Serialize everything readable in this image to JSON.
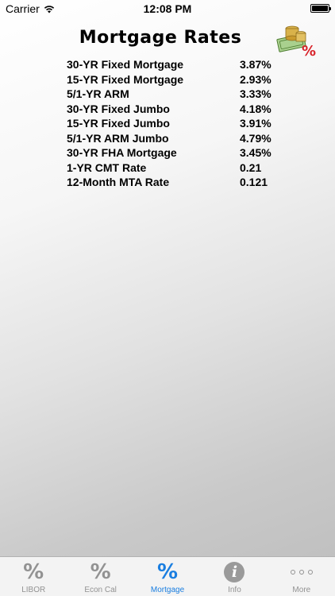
{
  "status_bar": {
    "carrier": "Carrier",
    "time": "12:08 PM"
  },
  "header": {
    "title": "Mortgage Rates",
    "icon": "money-percent-icon"
  },
  "rates": [
    {
      "label": "30-YR Fixed Mortgage",
      "value": "3.87%"
    },
    {
      "label": "15-YR Fixed Mortgage",
      "value": "2.93%"
    },
    {
      "label": "5/1-YR ARM",
      "value": "3.33%"
    },
    {
      "label": "30-YR Fixed Jumbo",
      "value": "4.18%"
    },
    {
      "label": "15-YR Fixed Jumbo",
      "value": "3.91%"
    },
    {
      "label": "5/1-YR ARM Jumbo",
      "value": "4.79%"
    },
    {
      "label": "30-YR FHA Mortgage",
      "value": "3.45%"
    },
    {
      "label": "1-YR CMT Rate",
      "value": "0.21"
    },
    {
      "label": "12-Month MTA Rate",
      "value": "0.121"
    }
  ],
  "tab_bar": {
    "active": "Mortgage",
    "accent_color": "#1a7ee0",
    "inactive_color": "#929292",
    "tabs": [
      {
        "label": "LIBOR",
        "icon": "percent-icon"
      },
      {
        "label": "Econ Cal",
        "icon": "percent-icon"
      },
      {
        "label": "Mortgage",
        "icon": "percent-icon"
      },
      {
        "label": "Info",
        "icon": "info-icon"
      },
      {
        "label": "More",
        "icon": "more-icon"
      }
    ]
  }
}
